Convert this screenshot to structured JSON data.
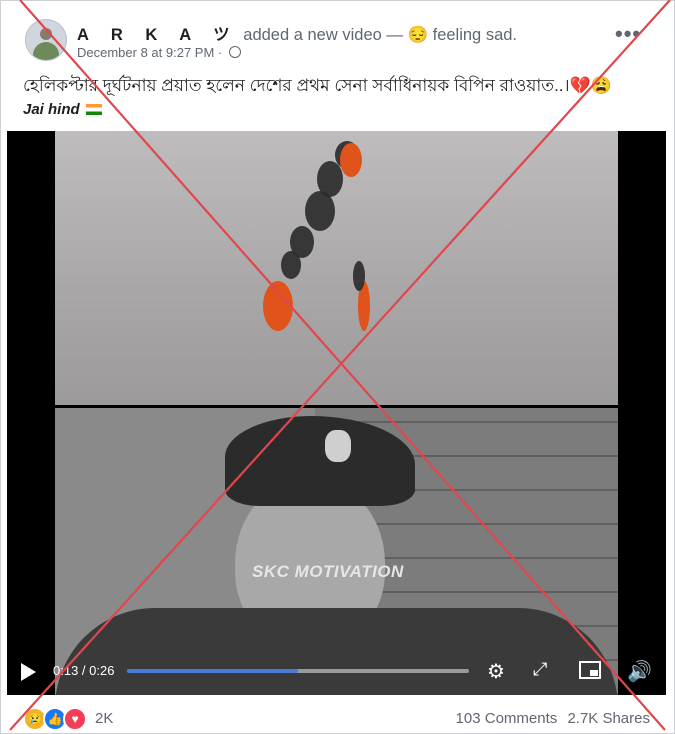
{
  "post": {
    "author_name": "A R K A ツ",
    "action_text": "added a new video — ",
    "feeling_text": "feeling sad.",
    "timestamp": "December 8 at 9:27 PM · ",
    "caption": "হেলিকপ্টার দূর্ঘটনায় প্রয়াত হলেন দেশের প্রথম সেনা সর্বাধিনায়ক বিপিন রাওয়াত..।",
    "tagline": "Jai hind",
    "menu_icon": "more-options-icon"
  },
  "video": {
    "watermark": "SKC MOTIVATION",
    "current_time": "0:13",
    "separator": " / ",
    "duration": "0:26",
    "progress_fraction": 0.5
  },
  "footer": {
    "reaction_count": "2K",
    "comments": "103 Comments",
    "shares": "2.7K Shares"
  },
  "colors": {
    "cross": "#e0474c",
    "progress": "#4a7bd6",
    "text_muted": "#606770"
  }
}
